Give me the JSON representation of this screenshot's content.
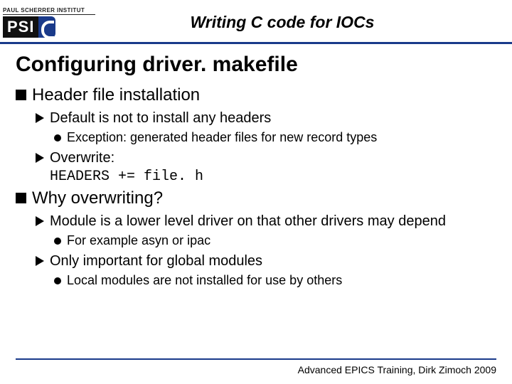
{
  "logo": {
    "institute": "PAUL SCHERRER INSTITUT",
    "abbrev": "PSI"
  },
  "slide_title": "Writing C code for IOCs",
  "heading": "Configuring driver. makefile",
  "bullets": {
    "b1": "Header file installation",
    "b1a": "Default is not to install any headers",
    "b1a1": "Exception: generated header files for new record types",
    "b1b_prefix": "Overwrite:",
    "b1b_code": "HEADERS += file. h",
    "b2": "Why overwriting?",
    "b2a": "Module is a lower level driver on that other drivers may depend",
    "b2a1": "For example asyn or ipac",
    "b2b": "Only important for global modules",
    "b2b1": "Local modules are not installed for use by others"
  },
  "footer": "Advanced EPICS Training, Dirk Zimoch 2009"
}
